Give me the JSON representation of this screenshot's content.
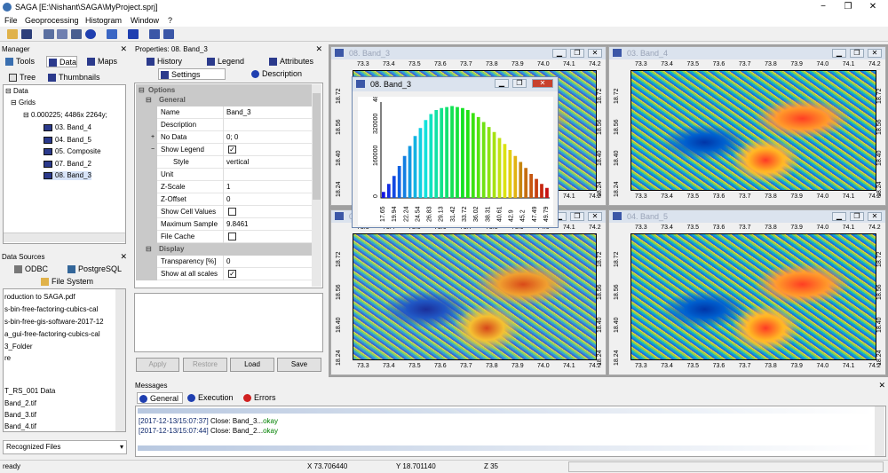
{
  "app": {
    "title": "SAGA [E:\\Nishant\\SAGA\\MyProject.sprj]"
  },
  "menu": [
    "File",
    "Geoprocessing",
    "Histogram",
    "Window",
    "?"
  ],
  "manager": {
    "title": "Manager",
    "tabs": [
      "Tools",
      "Data",
      "Maps"
    ],
    "subtabs": [
      "Tree",
      "Thumbnails"
    ],
    "tree": {
      "root": "Data",
      "grids": "Grids",
      "system": "0.000225; 4486x 2264y;",
      "items": [
        "03. Band_4",
        "04. Band_5",
        "05. Composite",
        "07. Band_2",
        "08. Band_3"
      ]
    }
  },
  "datasources": {
    "title": "Data Sources",
    "tabs": [
      "ODBC",
      "PostgreSQL",
      "File System"
    ],
    "files": [
      "roduction to SAGA.pdf",
      "s-bin-free-factoring-cubics-cal",
      "s-bin-free-gis-software-2017-12",
      "a_gui-free-factoring-cubics-cal",
      "3_Folder",
      "re",
      "",
      "T_RS_001 Data",
      "Band_2.tif",
      "Band_3.tif",
      "Band_4.tif"
    ],
    "footer": "Recognized Files"
  },
  "properties": {
    "title": "Properties: 08. Band_3",
    "tabs": [
      "History",
      "Legend",
      "Attributes"
    ],
    "subtabs": [
      "Settings",
      "Description"
    ],
    "rows": [
      {
        "type": "group",
        "label": "Options",
        "indent": 0
      },
      {
        "type": "group",
        "label": "General",
        "indent": 1
      },
      {
        "k": "Name",
        "v": "Band_3"
      },
      {
        "k": "Description",
        "v": ""
      },
      {
        "k": "No Data",
        "v": "0; 0",
        "plus": "+"
      },
      {
        "k": "Show Legend",
        "check": true,
        "minus": "−"
      },
      {
        "k": "Style",
        "v": "vertical",
        "sub": true
      },
      {
        "k": "Unit",
        "v": ""
      },
      {
        "k": "Z-Scale",
        "v": "1"
      },
      {
        "k": "Z-Offset",
        "v": "0"
      },
      {
        "k": "Show Cell Values",
        "check": false
      },
      {
        "k": "Maximum Sample",
        "v": "9.8461"
      },
      {
        "k": "File Cache",
        "check": false
      },
      {
        "type": "group",
        "label": "Display",
        "indent": 1
      },
      {
        "k": "Transparency [%]",
        "v": "0"
      },
      {
        "k": "Show at all scales",
        "check": true
      }
    ],
    "buttons": [
      "Apply",
      "Restore",
      "Load",
      "Save"
    ]
  },
  "maps": [
    {
      "title": "08. Band_3"
    },
    {
      "title": "03. Band_4"
    },
    {
      "title": "07. Band_2"
    },
    {
      "title": "04. Band_5"
    }
  ],
  "xticks": [
    "73.3",
    "73.4",
    "73.5",
    "73.6",
    "73.7",
    "73.8",
    "73.9",
    "74.0",
    "74.1",
    "74.2"
  ],
  "yticks": [
    "18.72",
    "18.56",
    "18.40",
    "18.24"
  ],
  "histogram": {
    "title": "08. Band_3",
    "chart_data": {
      "type": "bar",
      "x_tick_labels": [
        "17.65",
        "19.94",
        "22.24",
        "24.54",
        "26.83",
        "29.13",
        "31.42",
        "33.72",
        "36.02",
        "38.31",
        "40.61",
        "42.9",
        "45.2",
        "47.49",
        "49.79"
      ],
      "y_tick_labels": [
        "0",
        "160000",
        "320000",
        "480000"
      ],
      "ylim": [
        0,
        480000
      ],
      "values": [
        30000,
        70000,
        110000,
        160000,
        210000,
        260000,
        310000,
        350000,
        390000,
        420000,
        440000,
        450000,
        455000,
        460000,
        455000,
        450000,
        440000,
        425000,
        405000,
        380000,
        355000,
        330000,
        300000,
        270000,
        240000,
        210000,
        180000,
        150000,
        120000,
        95000,
        70000,
        50000
      ]
    }
  },
  "messages": {
    "title": "Messages",
    "tabs": [
      "General",
      "Execution",
      "Errors"
    ],
    "lines": [
      {
        "ts": "[2017-12-13/15:07:37]",
        "text": " Close: Band_3...",
        "ok": "okay"
      },
      {
        "ts": "[2017-12-13/15:07:44]",
        "text": " Close: Band_2...",
        "ok": "okay"
      }
    ]
  },
  "status": {
    "left": "ready",
    "x": "X 73.706440",
    "y": "Y 18.701140",
    "z": "Z 35"
  },
  "colors": {
    "accent": "#0a246a",
    "okay": "#008000"
  }
}
